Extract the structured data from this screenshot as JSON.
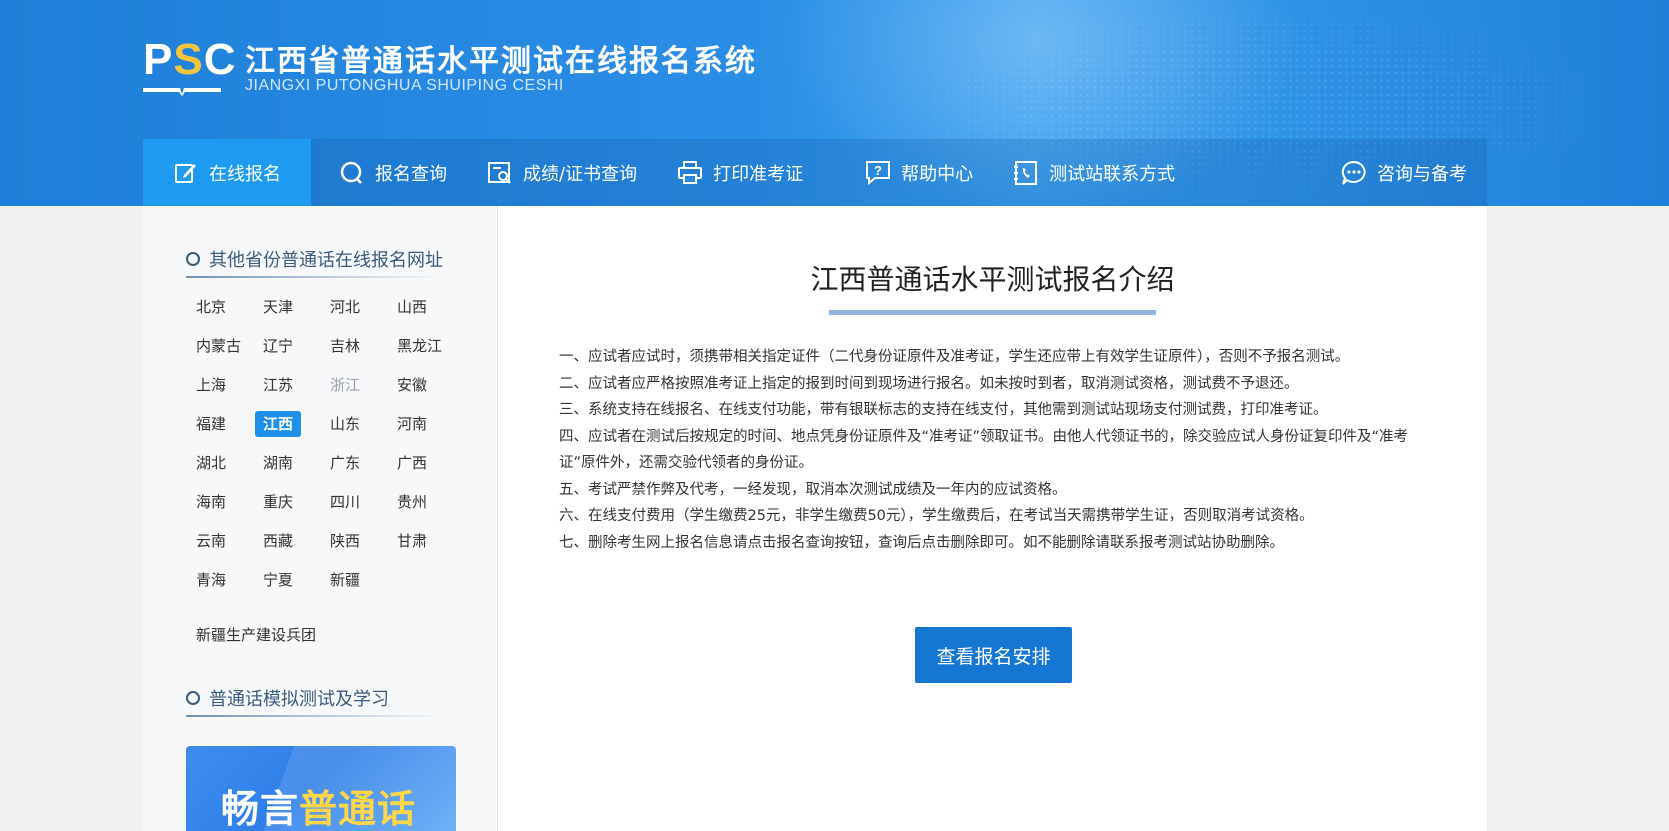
{
  "header": {
    "logo_text": "PSC",
    "title": "江西省普通话水平测试在线报名系统",
    "subtitle": "JIANGXI PUTONGHUA SHUIPING CESHI"
  },
  "nav": {
    "items": [
      {
        "label": "在线报名",
        "icon": "edit-icon"
      },
      {
        "label": "报名查询",
        "icon": "search-icon"
      },
      {
        "label": "成绩/证书查询",
        "icon": "certificate-search-icon"
      },
      {
        "label": "打印准考证",
        "icon": "printer-icon"
      },
      {
        "label": "帮助中心",
        "icon": "help-icon"
      },
      {
        "label": "测试站联系方式",
        "icon": "phone-book-icon"
      },
      {
        "label": "咨询与备考",
        "icon": "chat-icon"
      }
    ]
  },
  "sidebar": {
    "provinces_title": "其他省份普通话在线报名网址",
    "provinces": [
      "北京",
      "天津",
      "河北",
      "山西",
      "内蒙古",
      "辽宁",
      "吉林",
      "黑龙江",
      "上海",
      "江苏",
      "浙江",
      "安徽",
      "福建",
      "江西",
      "山东",
      "河南",
      "湖北",
      "湖南",
      "广东",
      "广西",
      "海南",
      "重庆",
      "四川",
      "贵州",
      "云南",
      "西藏",
      "陕西",
      "甘肃",
      "青海",
      "宁夏",
      "新疆"
    ],
    "active_province": "江西",
    "muted_province": "浙江",
    "extra": "新疆生产建设兵团",
    "study_title": "普通话模拟测试及学习",
    "banner_text_a": "畅言",
    "banner_text_b": "普通话"
  },
  "content": {
    "title": "江西普通话水平测试报名介绍",
    "rules": [
      "一、应试者应试时，须携带相关指定证件（二代身份证原件及准考证，学生还应带上有效学生证原件），否则不予报名测试。",
      "二、应试者应严格按照准考证上指定的报到时间到现场进行报名。如未按时到者，取消测试资格，测试费不予退还。",
      "三、系统支持在线报名、在线支付功能，带有银联标志的支持在线支付，其他需到测试站现场支付测试费，打印准考证。",
      "四、应试者在测试后按规定的时间、地点凭身份证原件及“准考证”领取证书。由他人代领证书的，除交验应试人身份证复印件及“准考证”原件外，还需交验代领者的身份证。",
      "五、考试严禁作弊及代考，一经发现，取消本次测试成绩及一年内的应试资格。",
      "六、在线支付费用（学生缴费25元，非学生缴费50元），学生缴费后，在考试当天需携带学生证，否则取消考试资格。",
      "七、删除考生网上报名信息请点击报名查询按钮，查询后点击删除即可。如不能删除请联系报考测试站协助删除。"
    ],
    "button_label": "查看报名安排"
  },
  "colors": {
    "header_blue": "#1f7fd8",
    "nav_active": "#1e9af0",
    "button_blue": "#1677d2",
    "logo_yellow": "#f2c53d"
  }
}
